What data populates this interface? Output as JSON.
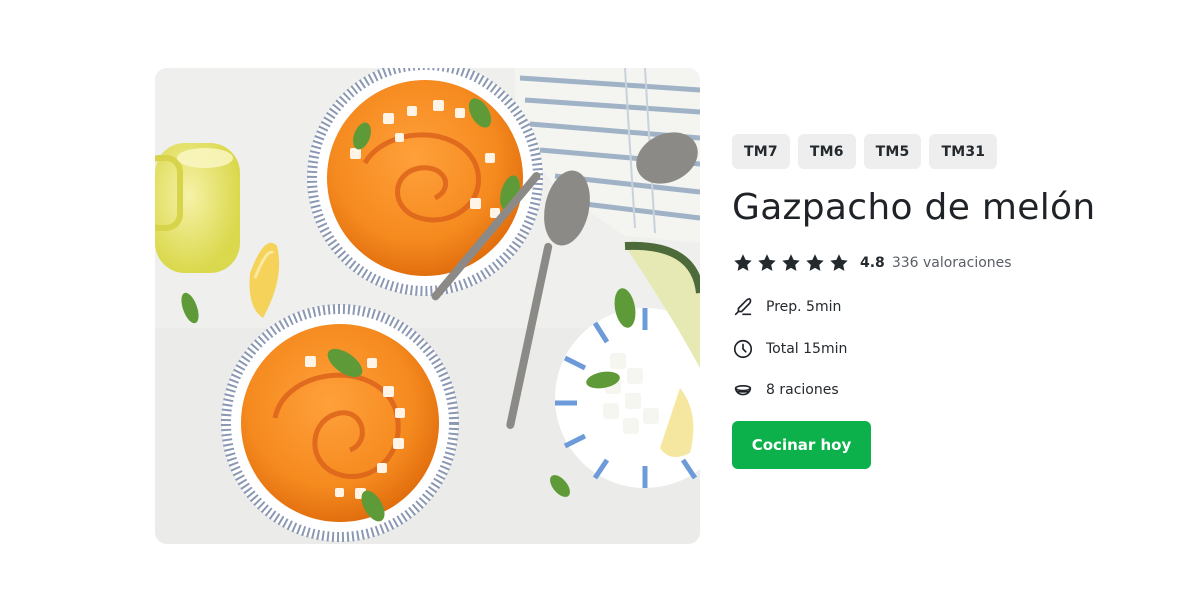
{
  "recipe": {
    "image_alt": "Gazpacho de melón",
    "tags": [
      "TM7",
      "TM6",
      "TM5",
      "TM31"
    ],
    "title": "Gazpacho de melón",
    "rating": {
      "stars_filled": 5,
      "stars_total": 5,
      "value": "4.8",
      "count_label": "336 valoraciones"
    },
    "facts": {
      "prep": {
        "icon": "knife-icon",
        "label": "Prep. 5min"
      },
      "total": {
        "icon": "clock-icon",
        "label": "Total 15min"
      },
      "servings": {
        "icon": "bowl-icon",
        "label": "8 raciones"
      }
    },
    "cta_label": "Cocinar hoy"
  },
  "colors": {
    "primary_button": "#0db14b",
    "tag_background": "#eeeeee",
    "text": "#1f2328",
    "star": "#24292e"
  }
}
